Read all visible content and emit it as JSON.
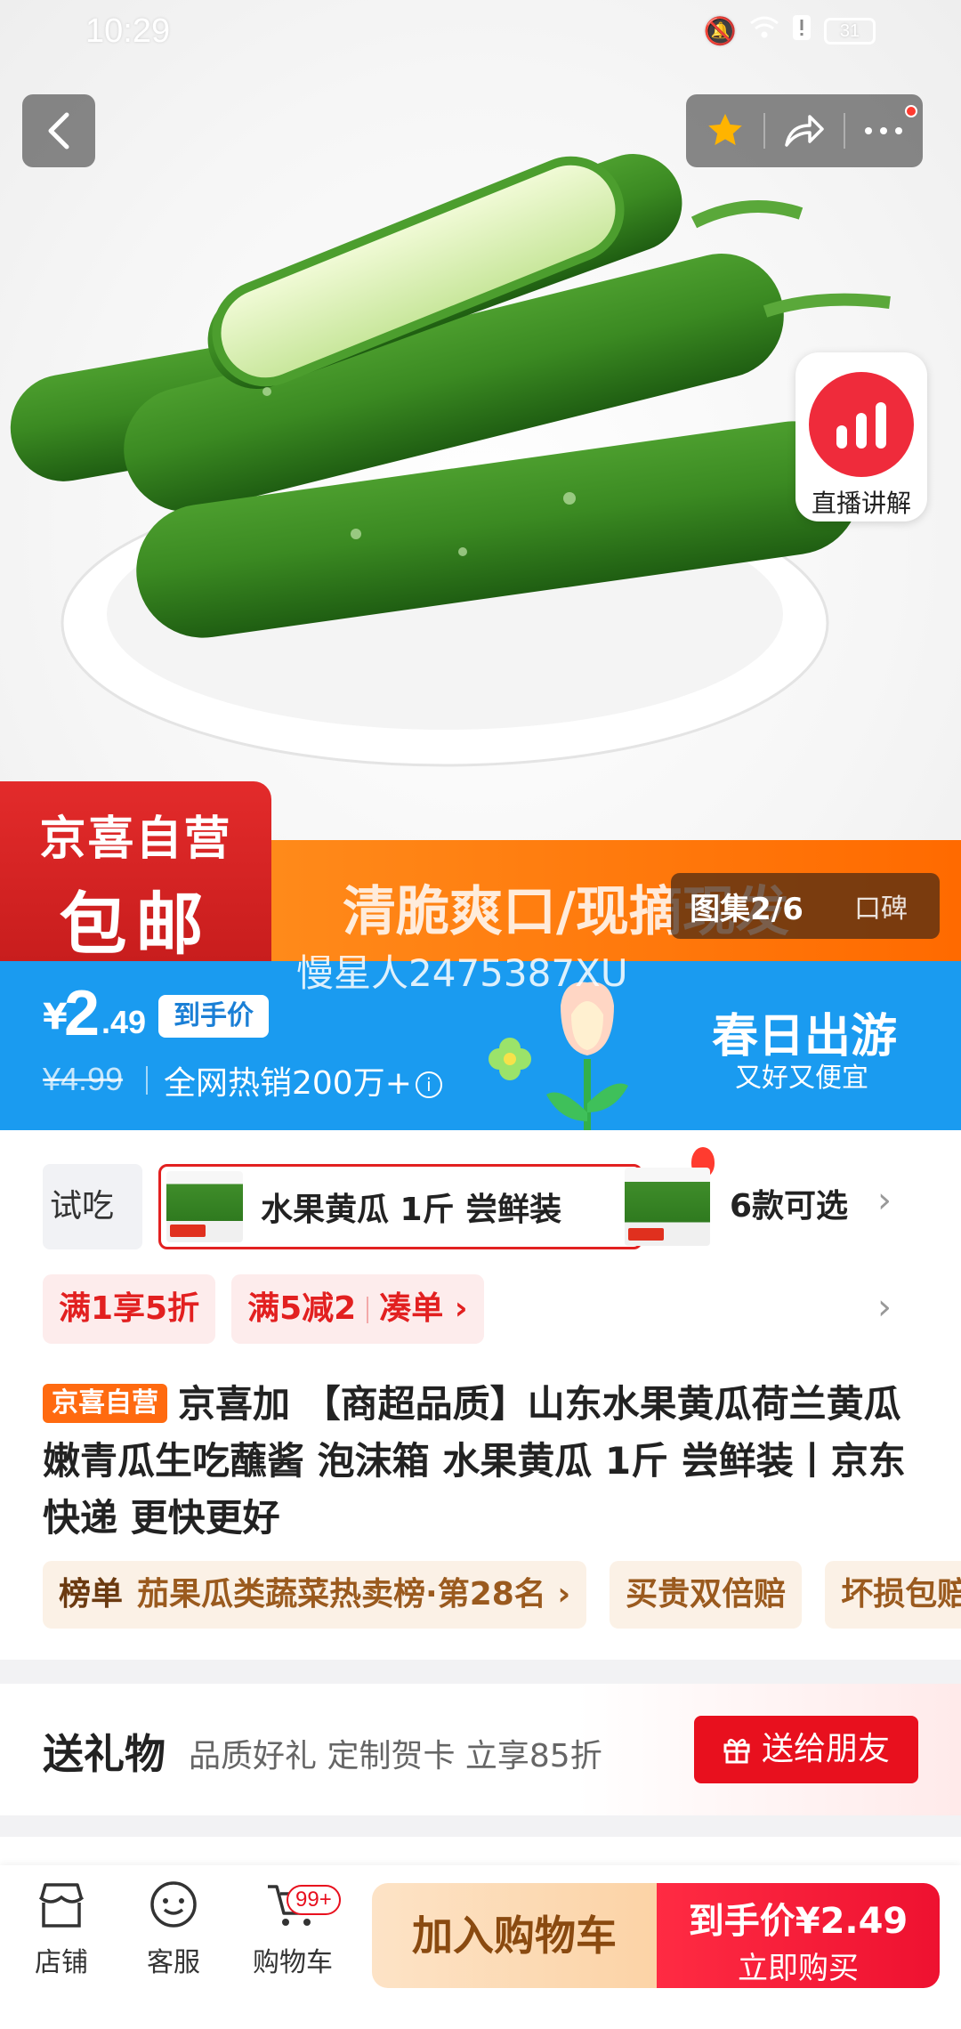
{
  "status_bar": {
    "time": "10:29",
    "battery": "31"
  },
  "gallery": {
    "counter": "图集2/6",
    "reviews_tab": "口碑"
  },
  "live": {
    "label": "直播讲解"
  },
  "banner": {
    "badge_line1": "京喜自营",
    "badge_line2": "包邮",
    "slogan": "清脆爽口/现摘现发"
  },
  "watermark": "慢星人2475387XU",
  "price": {
    "currency": "¥",
    "integer": "2",
    "decimal": ".49",
    "tag": "到手价",
    "original": "¥4.99",
    "hot_sales": "全网热销200万+",
    "promo_title": "春日出游",
    "promo_subtitle": "又好又便宜"
  },
  "variants": {
    "trial_label": "试吃",
    "selected_label": "水果黄瓜 1斤 尝鲜装",
    "more_label": "6款可选"
  },
  "promos": {
    "coupon1": "满1享5折",
    "coupon2": "满5减2",
    "coupon2_action": "凑单 ›"
  },
  "product": {
    "store_tag": "京喜自营",
    "title": "京喜加 【商超品质】山东水果黄瓜荷兰黄瓜嫩青瓜生吃蘸酱 泡沫箱 水果黄瓜 1斤 尝鲜装丨京东快递 更快更好"
  },
  "ranking": {
    "label": "榜单",
    "text": "茄果瓜类蔬菜热卖榜·第28名 ›",
    "guarantee": "买贵双倍赔",
    "damage": "坏损包赔"
  },
  "gift": {
    "title": "送礼物",
    "subtitle": "品质好礼 定制贺卡 立享85折",
    "button": "送给朋友"
  },
  "bottom_nav": {
    "store": "店铺",
    "service": "客服",
    "cart": "购物车",
    "cart_badge": "99+",
    "add_to_cart": "加入购物车",
    "buy_price_label": "到手价¥2.49",
    "buy_now": "立即购买"
  },
  "colors": {
    "accent_red": "#e8101e",
    "price_blue": "#1a9bf0",
    "banner_orange": "#ff6a00"
  }
}
